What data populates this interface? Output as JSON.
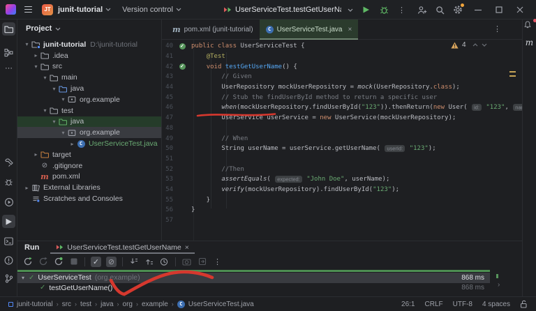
{
  "titlebar": {
    "project_initials": "JT",
    "project_name": "junit-tutorial",
    "vcs": "Version control",
    "run_config": "UserServiceTest.testGetUserName"
  },
  "tabs": {
    "pom": {
      "label": "pom.xml (junit-tutorial)"
    },
    "test": {
      "label": "UserServiceTest.java"
    }
  },
  "editor": {
    "warning_count": "4",
    "maven_rail_label": "m",
    "lines": [
      {
        "n": 40,
        "g": "run",
        "segs": [
          [
            "public class ",
            "kw"
          ],
          [
            "UserServiceTest {",
            "plain"
          ]
        ]
      },
      {
        "n": 41,
        "segs": [
          [
            "    ",
            "plain"
          ],
          [
            "@Test",
            "ann"
          ]
        ]
      },
      {
        "n": 42,
        "g": "run",
        "segs": [
          [
            "    ",
            "plain"
          ],
          [
            "void ",
            "kw"
          ],
          [
            "testGetUserName",
            "method"
          ],
          [
            "() {",
            "plain"
          ]
        ]
      },
      {
        "n": 43,
        "segs": [
          [
            "        ",
            "plain"
          ],
          [
            "// Given",
            "cmt"
          ]
        ]
      },
      {
        "n": 44,
        "segs": [
          [
            "        UserRepository mockUserRepository = ",
            "plain"
          ],
          [
            "mock",
            "italic"
          ],
          [
            "(UserRepository.",
            "plain"
          ],
          [
            "class",
            "kw"
          ],
          [
            ");",
            "plain"
          ]
        ]
      },
      {
        "n": 45,
        "segs": [
          [
            "        ",
            "plain"
          ],
          [
            "// Stub the findUserById method to return a specific user",
            "cmt"
          ]
        ]
      },
      {
        "n": 46,
        "segs": [
          [
            "        ",
            "plain"
          ],
          [
            "when",
            "italic"
          ],
          [
            "(mockUserRepository.findUserById(",
            "plain"
          ],
          [
            "\"123\"",
            "str"
          ],
          [
            ")).thenReturn(",
            "plain"
          ],
          [
            "new ",
            "kw"
          ],
          [
            "User( ",
            "plain"
          ],
          [
            "id:",
            "chip"
          ],
          [
            " ",
            "plain"
          ],
          [
            "\"123\"",
            "str"
          ],
          [
            ", ",
            "plain"
          ],
          [
            "nam",
            "chip"
          ]
        ]
      },
      {
        "n": 47,
        "segs": [
          [
            "        UserService userService = ",
            "plain"
          ],
          [
            "new ",
            "kw"
          ],
          [
            "UserService(mockUserRepository);",
            "plain"
          ]
        ]
      },
      {
        "n": 48,
        "segs": []
      },
      {
        "n": 49,
        "segs": [
          [
            "        ",
            "plain"
          ],
          [
            "// When",
            "cmt"
          ]
        ]
      },
      {
        "n": 50,
        "segs": [
          [
            "        String userName = userService.getUserName( ",
            "plain"
          ],
          [
            "userId:",
            "chip"
          ],
          [
            " ",
            "plain"
          ],
          [
            "\"123\"",
            "str"
          ],
          [
            ");",
            "plain"
          ]
        ]
      },
      {
        "n": 51,
        "segs": []
      },
      {
        "n": 52,
        "segs": [
          [
            "        ",
            "plain"
          ],
          [
            "//Then",
            "cmt"
          ]
        ]
      },
      {
        "n": 53,
        "segs": [
          [
            "        ",
            "plain"
          ],
          [
            "assertEquals",
            "italic"
          ],
          [
            "( ",
            "plain"
          ],
          [
            "expected:",
            "chip"
          ],
          [
            " ",
            "plain"
          ],
          [
            "\"John Doe\"",
            "str"
          ],
          [
            ", userName);",
            "plain"
          ]
        ]
      },
      {
        "n": 54,
        "segs": [
          [
            "        ",
            "plain"
          ],
          [
            "verify",
            "italic"
          ],
          [
            "(mockUserRepository).findUserById(",
            "plain"
          ],
          [
            "\"123\"",
            "str"
          ],
          [
            ");",
            "plain"
          ]
        ]
      },
      {
        "n": 55,
        "segs": [
          [
            "    }",
            "plain"
          ]
        ]
      },
      {
        "n": 56,
        "segs": [
          [
            "}",
            "plain"
          ]
        ]
      },
      {
        "n": 57,
        "segs": []
      }
    ]
  },
  "project": {
    "header": "Project",
    "items": [
      {
        "label": "junit-tutorial",
        "extra": "D:\\junit-tutorial",
        "icon": "project-folder",
        "indent": 0,
        "chevron": "down",
        "bold": true
      },
      {
        "label": ".idea",
        "icon": "folder",
        "indent": 1,
        "chevron": "right"
      },
      {
        "label": "src",
        "icon": "folder",
        "indent": 1,
        "chevron": "down"
      },
      {
        "label": "main",
        "icon": "folder",
        "indent": 2,
        "chevron": "down"
      },
      {
        "label": "java",
        "icon": "folder-src",
        "indent": 3,
        "chevron": "down"
      },
      {
        "label": "org.example",
        "icon": "package",
        "indent": 4,
        "chevron": "down"
      },
      {
        "label": "test",
        "icon": "folder",
        "indent": 2,
        "chevron": "down"
      },
      {
        "label": "java",
        "icon": "folder-test",
        "indent": 3,
        "chevron": "down",
        "highlight": "green"
      },
      {
        "label": "org.example",
        "icon": "package",
        "indent": 4,
        "chevron": "down",
        "highlight": "gray"
      },
      {
        "label": "UserServiceTest.java",
        "icon": "class",
        "indent": 5,
        "chevron": "right",
        "color": "green"
      },
      {
        "label": "target",
        "icon": "folder-excluded",
        "indent": 1,
        "chevron": "right"
      },
      {
        "label": ".gitignore",
        "icon": "ignore",
        "indent": 1
      },
      {
        "label": "pom.xml",
        "icon": "maven",
        "indent": 1
      },
      {
        "label": "External Libraries",
        "icon": "library",
        "indent": 0,
        "chevron": "right"
      },
      {
        "label": "Scratches and Consoles",
        "icon": "scratches",
        "indent": 0
      }
    ]
  },
  "run": {
    "panel_label": "Run",
    "tab_label": "UserServiceTest.testGetUserName",
    "rows": [
      {
        "name": "UserServiceTest",
        "package": "(org.example)",
        "duration": "868 ms",
        "selected": true,
        "level": 0
      },
      {
        "name": "testGetUserName()",
        "package": "",
        "duration": "868 ms",
        "selected": false,
        "level": 1
      }
    ]
  },
  "status": {
    "crumbs": [
      "junit-tutorial",
      "src",
      "test",
      "java",
      "org",
      "example",
      "UserServiceTest.java"
    ],
    "caret": "26:1",
    "eol": "CRLF",
    "encoding": "UTF-8",
    "indent": "4 spaces"
  },
  "colors": {
    "accent_green": "#5fb865",
    "passed_green": "#57965c",
    "warning_yellow": "#d6a35c",
    "annotation_red": "#d6382e",
    "added_file_green": "#6aab73"
  }
}
